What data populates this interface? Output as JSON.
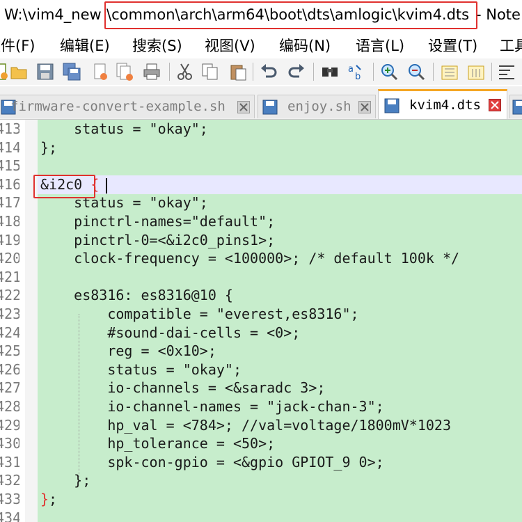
{
  "window": {
    "title_prefix": "W:\\vim4_new",
    "title_path": "\\common\\arch\\arm64\\boot\\dts\\amlogic\\kvim4.dts",
    "title_suffix": " - Note"
  },
  "menu": {
    "items": [
      "文件(F)",
      "编辑(E)",
      "搜索(S)",
      "视图(V)",
      "编码(N)",
      "语言(L)",
      "设置(T)",
      "工具"
    ]
  },
  "toolbar": {
    "icons": [
      "new-file-icon",
      "open-file-icon",
      "save-icon",
      "save-all-icon",
      "close-icon",
      "close-all-icon",
      "print-icon",
      "cut-icon",
      "copy-icon",
      "paste-icon",
      "undo-icon",
      "redo-icon",
      "find-icon",
      "replace-icon",
      "zoom-in-icon",
      "zoom-out-icon",
      "sync-vertical-icon",
      "sync-horizontal-icon",
      "word-wrap-icon"
    ]
  },
  "tabs": [
    {
      "label": "firmware-convert-example.sh",
      "active": false
    },
    {
      "label": "enjoy.sh",
      "active": false
    },
    {
      "label": "kvim4.dts",
      "active": true
    }
  ],
  "editor": {
    "lines": [
      {
        "num": "413",
        "text": "    status = \"okay\";"
      },
      {
        "num": "414",
        "text": "};"
      },
      {
        "num": "415",
        "text": ""
      },
      {
        "num": "416",
        "text": "&i2c0 {"
      },
      {
        "num": "417",
        "text": "    status = \"okay\";"
      },
      {
        "num": "418",
        "text": "    pinctrl-names=\"default\";"
      },
      {
        "num": "419",
        "text": "    pinctrl-0=<&i2c0_pins1>;"
      },
      {
        "num": "420",
        "text": "    clock-frequency = <100000>; /* default 100k */"
      },
      {
        "num": "421",
        "text": ""
      },
      {
        "num": "422",
        "text": "    es8316: es8316@10 {"
      },
      {
        "num": "423",
        "text": "        compatible = \"everest,es8316\";"
      },
      {
        "num": "424",
        "text": "        #sound-dai-cells = <0>;"
      },
      {
        "num": "425",
        "text": "        reg = <0x10>;"
      },
      {
        "num": "426",
        "text": "        status = \"okay\";"
      },
      {
        "num": "427",
        "text": "        io-channels = <&saradc 3>;"
      },
      {
        "num": "428",
        "text": "        io-channel-names = \"jack-chan-3\";"
      },
      {
        "num": "429",
        "text": "        hp_val = <784>; //val=voltage/1800mV*1023"
      },
      {
        "num": "430",
        "text": "        hp_tolerance = <50>;"
      },
      {
        "num": "431",
        "text": "        spk-con-gpio = <&gpio GPIOT_9 0>;"
      },
      {
        "num": "432",
        "text": "    };"
      },
      {
        "num": "433",
        "text": "};"
      },
      {
        "num": "434",
        "text": ""
      }
    ]
  },
  "colors": {
    "code_bg": "#c7edcc",
    "current_line_bg": "#e8e8ff",
    "highlight_box": "#e0312f",
    "active_tab_accent": "#f5a623"
  }
}
